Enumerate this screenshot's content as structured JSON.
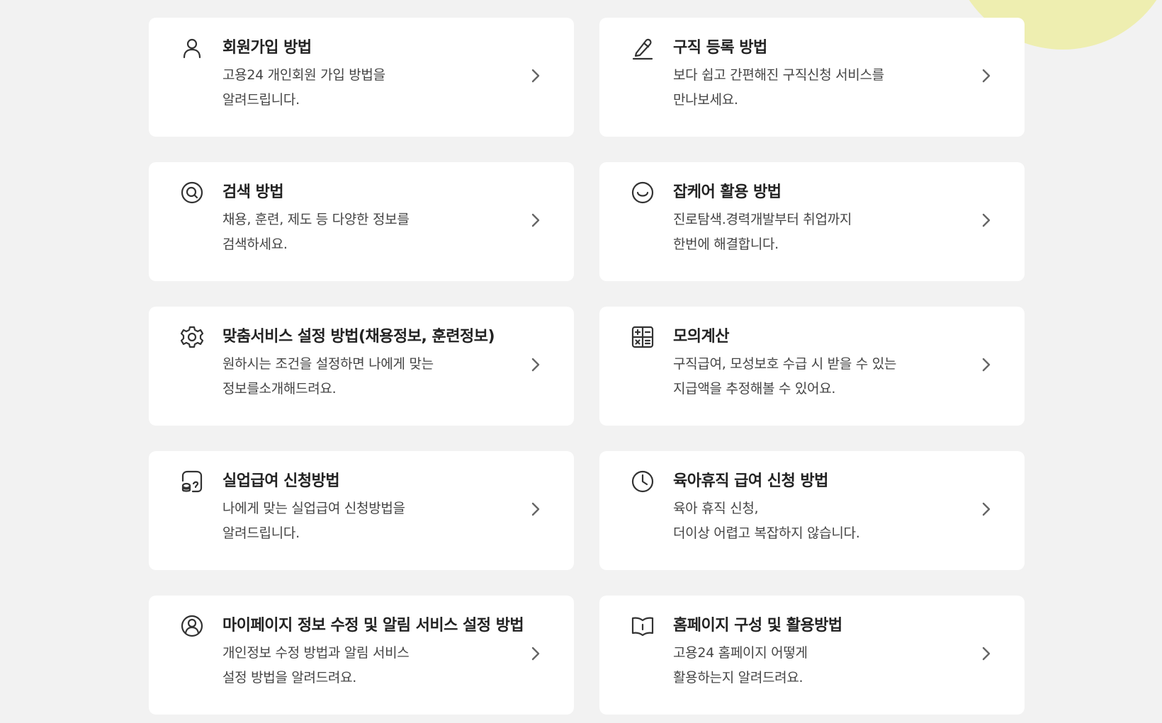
{
  "cards": [
    {
      "title": "회원가입 방법",
      "line1": "고용24 개인회원 가입 방법을",
      "line2": "알려드립니다.",
      "icon": "user-icon"
    },
    {
      "title": "구직 등록 방법",
      "line1": "보다 쉽고 간편해진 구직신청 서비스를",
      "line2": "만나보세요.",
      "icon": "pencil-icon"
    },
    {
      "title": "검색 방법",
      "line1": "채용, 훈련, 제도 등 다양한 정보를",
      "line2": "검색하세요.",
      "icon": "search-icon"
    },
    {
      "title": "잡케어 활용 방법",
      "line1": "진로탐색.경력개발부터 취업까지",
      "line2": "한번에 해결합니다.",
      "icon": "smile-icon"
    },
    {
      "title": "맞춤서비스 설정 방법(채용정보, 훈련정보)",
      "line1": "원하시는 조건을 설정하면 나에게 맞는",
      "line2": "정보를소개해드려요.",
      "icon": "gear-icon"
    },
    {
      "title": "모의계산",
      "line1": "구직급여, 모성보호 수급 시 받을 수 있는",
      "line2": "지급액을 추정해볼 수 있어요.",
      "icon": "calculator-icon"
    },
    {
      "title": "실업급여 신청방법",
      "line1": "나에게 맞는 실업급여 신청방법을",
      "line2": "알려드립니다.",
      "icon": "coins-icon"
    },
    {
      "title": "육아휴직 급여 신청 방법",
      "line1": "육아 휴직 신청,",
      "line2": "더이상 어렵고 복잡하지 않습니다.",
      "icon": "clock-icon"
    },
    {
      "title": "마이페이지 정보 수정 및 알림 서비스 설정 방법",
      "line1": "개인정보 수정 방법과 알림 서비스",
      "line2": "설정 방법을 알려드려요.",
      "icon": "user-circle-icon"
    },
    {
      "title": "홈페이지 구성 및 활용방법",
      "line1": "고용24 홈페이지 어떻게",
      "line2": "활용하는지 알려드려요.",
      "icon": "book-icon"
    }
  ],
  "colors": {
    "background": "#f2f2f2",
    "card": "#ffffff",
    "accent_circle": "#eeeeb0"
  }
}
